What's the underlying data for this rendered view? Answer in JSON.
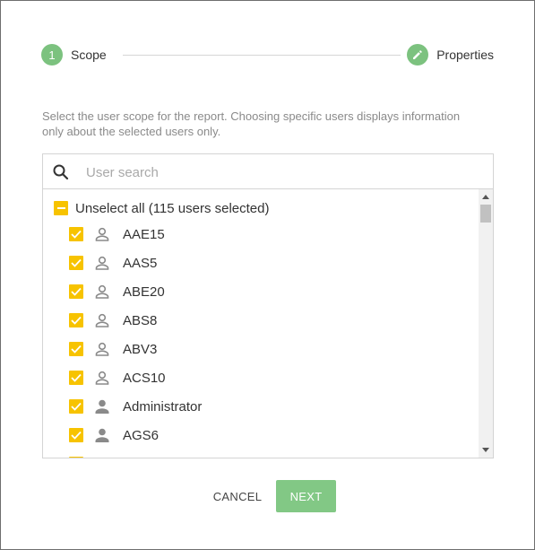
{
  "stepper": {
    "steps": [
      {
        "number": "1",
        "label": "Scope"
      },
      {
        "label": "Properties",
        "icon": "pencil-icon"
      }
    ]
  },
  "description": "Select the user scope for the report. Choosing specific users displays information only about the selected users only.",
  "search": {
    "placeholder": "User search",
    "value": ""
  },
  "list": {
    "select_all_label": "Unselect all (115 users selected)",
    "users": [
      {
        "name": "AAE15",
        "icon": "user-outline-icon",
        "checked": true
      },
      {
        "name": "AAS5",
        "icon": "user-outline-icon",
        "checked": true
      },
      {
        "name": "ABE20",
        "icon": "user-outline-icon",
        "checked": true
      },
      {
        "name": "ABS8",
        "icon": "user-outline-icon",
        "checked": true
      },
      {
        "name": "ABV3",
        "icon": "user-outline-icon",
        "checked": true
      },
      {
        "name": "ACS10",
        "icon": "user-outline-icon",
        "checked": true
      },
      {
        "name": "Administrator",
        "icon": "user-filled-icon",
        "checked": true
      },
      {
        "name": "AGS6",
        "icon": "user-filled-icon",
        "checked": true
      }
    ]
  },
  "footer": {
    "cancel_label": "CANCEL",
    "next_label": "NEXT"
  },
  "colors": {
    "accent_green": "#7cc27f",
    "checkbox_yellow": "#f7c300"
  }
}
